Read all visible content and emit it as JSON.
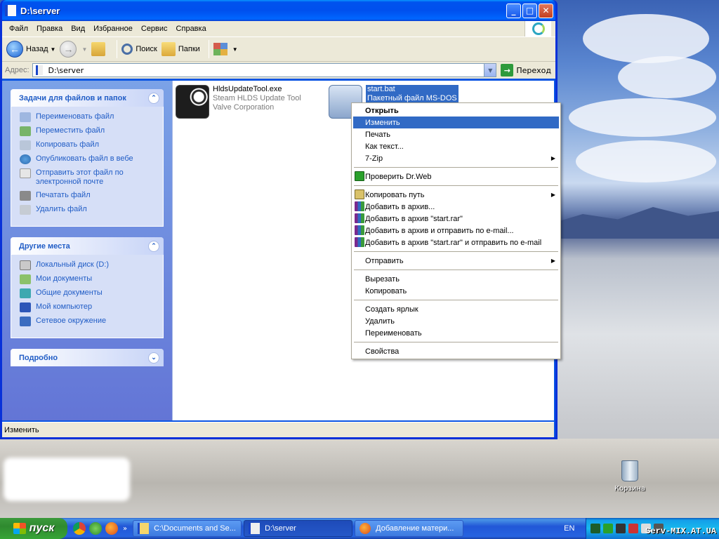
{
  "window": {
    "title": "D:\\server"
  },
  "menu": [
    "Файл",
    "Правка",
    "Вид",
    "Избранное",
    "Сервис",
    "Справка"
  ],
  "toolbar": {
    "back": "Назад",
    "search": "Поиск",
    "folders": "Папки"
  },
  "address": {
    "label": "Адрес:",
    "value": "D:\\server",
    "go": "Переход"
  },
  "tasks_panel": {
    "title": "Задачи для файлов и папок",
    "items": [
      "Переименовать файл",
      "Переместить файл",
      "Копировать файл",
      "Опубликовать файл в вебе",
      "Отправить этот файл по электронной почте",
      "Печатать файл",
      "Удалить файл"
    ]
  },
  "places_panel": {
    "title": "Другие места",
    "items": [
      "Локальный диск (D:)",
      "Мои документы",
      "Общие документы",
      "Мой компьютер",
      "Сетевое окружение"
    ]
  },
  "details_panel": {
    "title": "Подробно"
  },
  "files": [
    {
      "name": "HldsUpdateTool.exe",
      "line2": "Steam HLDS Update Tool",
      "line3": "Valve Corporation"
    },
    {
      "name": "start.bat",
      "line2": "Пакетный файл MS-DOS"
    }
  ],
  "context_menu": {
    "open": "Открыть",
    "edit": "Изменить",
    "print": "Печать",
    "as_text": "Как текст...",
    "zip": "7-Zip",
    "drweb": "Проверить Dr.Web",
    "copy_path": "Копировать путь",
    "add_archive": "Добавить в архив...",
    "add_start_rar": "Добавить в архив \"start.rar\"",
    "add_email": "Добавить в архив и отправить по e-mail...",
    "add_start_rar_email": "Добавить в архив \"start.rar\" и отправить по e-mail",
    "send_to": "Отправить",
    "cut": "Вырезать",
    "copy": "Копировать",
    "shortcut": "Создать ярлык",
    "delete": "Удалить",
    "rename": "Переименовать",
    "properties": "Свойства"
  },
  "status": "Изменить",
  "desktop": {
    "recycle_bin": "Корзина"
  },
  "taskbar": {
    "start": "пуск",
    "tasks": [
      "C:\\Documents and Se...",
      "D:\\server",
      "Добавление матери..."
    ],
    "lang": "EN",
    "watermark": "Serv-MIX.AT.UA",
    "chevron": "»"
  },
  "colors": {
    "selection": "#316ac5",
    "titlebar": "#0053ee",
    "link": "#215dc6"
  }
}
